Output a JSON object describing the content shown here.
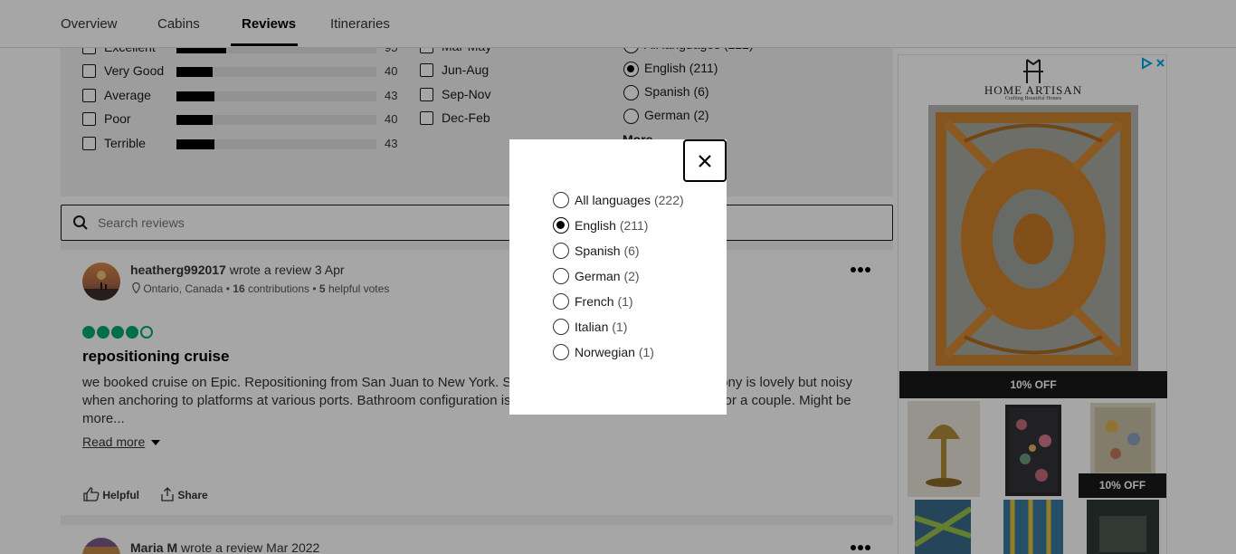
{
  "nav": {
    "tabs": [
      {
        "label": "Overview"
      },
      {
        "label": "Cabins"
      },
      {
        "label": "Reviews"
      },
      {
        "label": "Itineraries"
      }
    ]
  },
  "filters": {
    "rating": [
      {
        "label": "Excellent",
        "count": "95",
        "fraction": 0.25
      },
      {
        "label": "Very Good",
        "count": "40",
        "fraction": 0.18
      },
      {
        "label": "Average",
        "count": "43",
        "fraction": 0.19
      },
      {
        "label": "Poor",
        "count": "40",
        "fraction": 0.18
      },
      {
        "label": "Terrible",
        "count": "43",
        "fraction": 0.19
      }
    ],
    "season": [
      "Mar-May",
      "Jun-Aug",
      "Sep-Nov",
      "Dec-Feb"
    ],
    "language": [
      {
        "label": "All languages (222)"
      },
      {
        "label": "English (211)",
        "selected": true
      },
      {
        "label": "Spanish (6)"
      },
      {
        "label": "German (2)"
      }
    ],
    "more_label": "More"
  },
  "search": {
    "placeholder": "Search reviews"
  },
  "review": {
    "username": "heatherg992017",
    "wrote": "wrote a review 3 Apr",
    "location": "Ontario, Canada",
    "contributions": "16",
    "contributions_label": "contributions",
    "helpful_votes": "5",
    "helpful_votes_label": "helpful votes",
    "rating": 4,
    "title": "repositioning cruise",
    "body": "we booked cruise on Epic. Repositioning from San Juan to New York. Staff is great and the cabin with balcony is lovely but noisy when anchoring to platforms at various ports. Bathroom configuration is an interesting layout but it worked for a couple. Might be more...",
    "read_more": "Read more",
    "helpful_label": "Helpful",
    "share_label": "Share"
  },
  "review2": {
    "username": "Maria M",
    "wrote": "wrote a review Mar 2022"
  },
  "ad": {
    "brand": "HOME ARTISAN",
    "tagline": "Crafting Beautiful Homes",
    "banner1": "10% OFF",
    "banner2": "10% OFF"
  },
  "modal": {
    "options": [
      {
        "name": "All languages",
        "count": "(222)",
        "selected": false
      },
      {
        "name": "English",
        "count": "(211)",
        "selected": true
      },
      {
        "name": "Spanish",
        "count": "(6)",
        "selected": false
      },
      {
        "name": "German",
        "count": "(2)",
        "selected": false
      },
      {
        "name": "French",
        "count": "(1)",
        "selected": false
      },
      {
        "name": "Italian",
        "count": "(1)",
        "selected": false
      },
      {
        "name": "Norwegian",
        "count": "(1)",
        "selected": false
      }
    ]
  },
  "colors": {
    "accent": "#00aa6c",
    "selected_tab": "#000000"
  }
}
